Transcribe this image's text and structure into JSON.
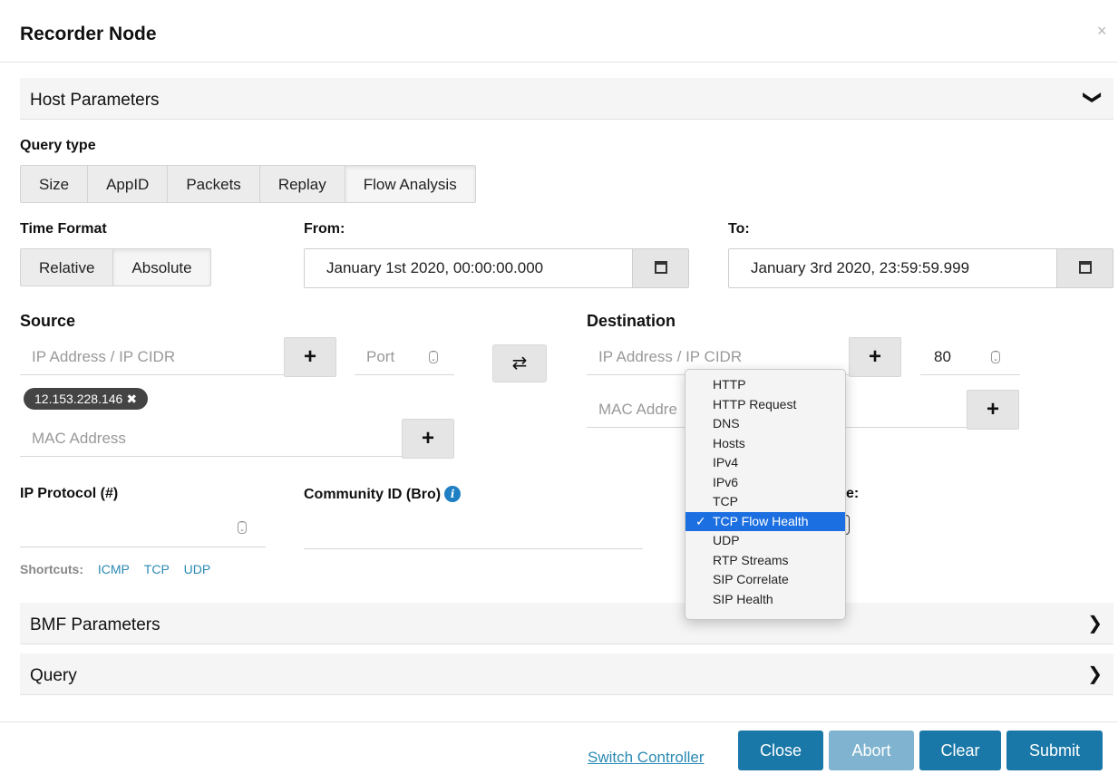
{
  "dialog": {
    "title": "Recorder Node"
  },
  "host": {
    "title": "Host Parameters",
    "query_type_label": "Query type",
    "query_types": [
      "Size",
      "AppID",
      "Packets",
      "Replay",
      "Flow Analysis"
    ],
    "time_format_label": "Time Format",
    "time_formats": [
      "Relative",
      "Absolute"
    ],
    "from_label": "From:",
    "from_value": "January 1st 2020, 00:00:00.000",
    "to_label": "To:",
    "to_value": "January 3rd 2020, 23:59:59.999"
  },
  "source": {
    "title": "Source",
    "ip_placeholder": "IP Address / IP CIDR",
    "port_placeholder": "Port",
    "tag": "12.153.228.146",
    "mac_placeholder": "MAC Address"
  },
  "destination": {
    "title": "Destination",
    "ip_placeholder": "IP Address / IP CIDR",
    "port_value": "80",
    "mac_placeholder": "MAC Addre"
  },
  "protocol": {
    "label": "IP Protocol (#)",
    "shortcuts_label": "Shortcuts:",
    "shortcuts": [
      "ICMP",
      "TCP",
      "UDP"
    ]
  },
  "community": {
    "label": "Community ID (Bro)"
  },
  "partial_label": "e:",
  "dropdown": {
    "options": [
      "HTTP",
      "HTTP Request",
      "DNS",
      "Hosts",
      "IPv4",
      "IPv6",
      "TCP",
      "TCP Flow Health",
      "UDP",
      "RTP Streams",
      "SIP Correlate",
      "SIP Health"
    ],
    "selected": "TCP Flow Health",
    "check_glyph": "✓"
  },
  "bmf": {
    "title": "BMF Parameters"
  },
  "query": {
    "title": "Query"
  },
  "footer": {
    "switch_controller": "Switch Controller",
    "close": "Close",
    "abort": "Abort",
    "clear": "Clear",
    "submit": "Submit"
  },
  "glyphs": {
    "close": "×",
    "chevron_down": "❯",
    "chevron_right": "❯",
    "plus": "+",
    "swap": "⇄",
    "tag_remove": "✖",
    "info": "i"
  }
}
